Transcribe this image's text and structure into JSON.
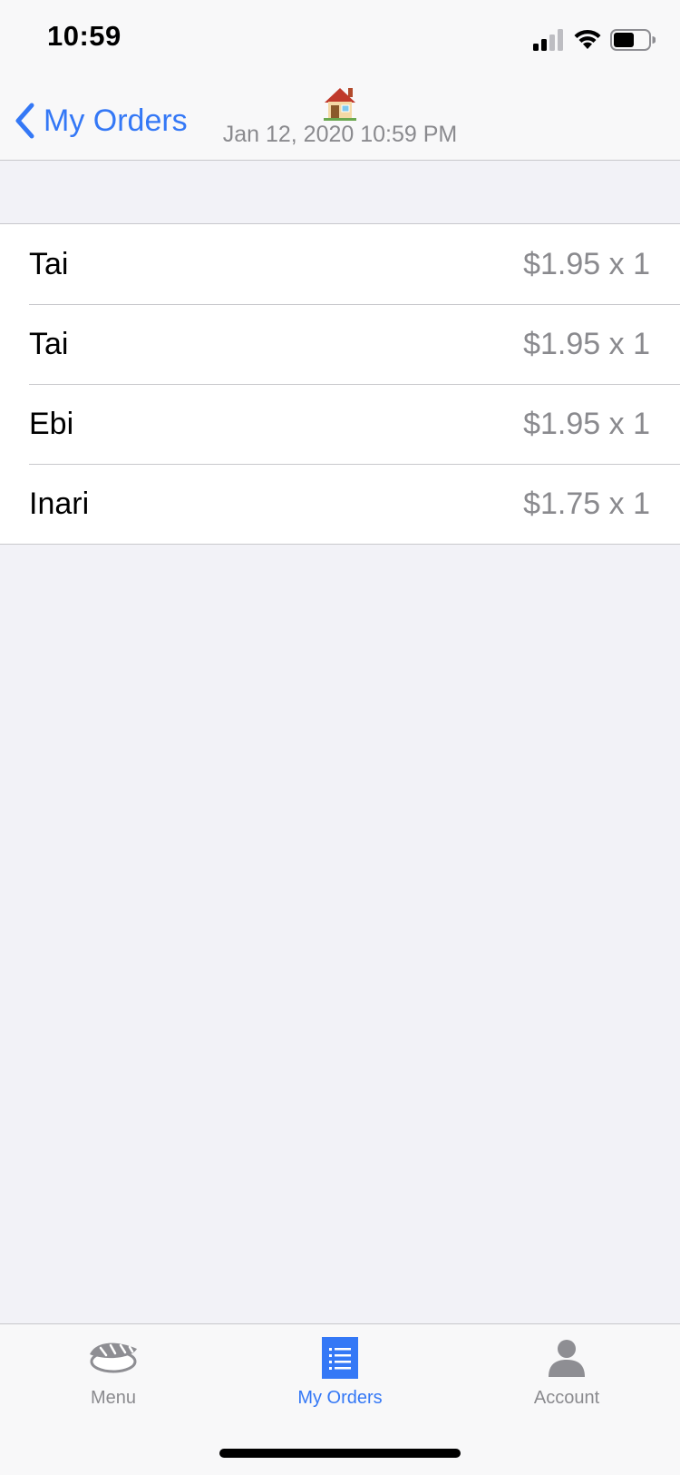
{
  "status_bar": {
    "time": "10:59"
  },
  "nav": {
    "back_label": "My Orders",
    "title_icon": "house-icon",
    "subtitle": "Jan 12, 2020 10:59 PM"
  },
  "orders": [
    {
      "name": "Tai",
      "price": "$1.95 x 1"
    },
    {
      "name": "Tai",
      "price": "$1.95 x 1"
    },
    {
      "name": "Ebi",
      "price": "$1.95 x 1"
    },
    {
      "name": "Inari",
      "price": "$1.75 x 1"
    }
  ],
  "tabs": [
    {
      "label": "Menu",
      "icon": "sushi-icon"
    },
    {
      "label": "My Orders",
      "icon": "order-list-icon"
    },
    {
      "label": "Account",
      "icon": "person-icon"
    }
  ],
  "colors": {
    "accent": "#3478f6",
    "secondary_text": "#8a8a8e",
    "background": "#f2f2f7"
  }
}
